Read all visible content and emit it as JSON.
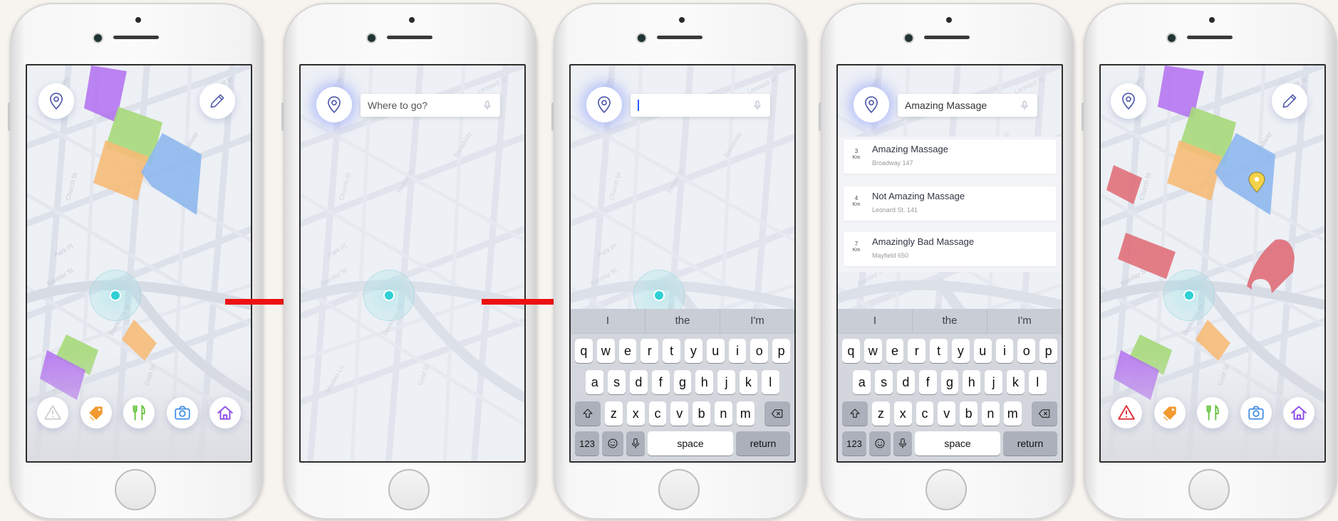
{
  "search": {
    "placeholder": "Where to go?",
    "query": "Amazing Massage"
  },
  "keyboard": {
    "suggestions": [
      "I",
      "the",
      "I'm"
    ],
    "row1": [
      "q",
      "w",
      "e",
      "r",
      "t",
      "y",
      "u",
      "i",
      "o",
      "p"
    ],
    "row2": [
      "a",
      "s",
      "d",
      "f",
      "g",
      "h",
      "j",
      "k",
      "l"
    ],
    "row3": [
      "z",
      "x",
      "c",
      "v",
      "b",
      "n",
      "m"
    ],
    "numbers_label": "123",
    "space_label": "space",
    "return_label": "return"
  },
  "results": [
    {
      "distance": "3",
      "unit": "Km",
      "title": "Amazing Massage",
      "address": "Broadway 147"
    },
    {
      "distance": "4",
      "unit": "Km",
      "title": "Not Amazing Massage",
      "address": "Leonard St. 141"
    },
    {
      "distance": "7",
      "unit": "Km",
      "title": "Amazingly Bad Massage",
      "address": "Mayfield 650"
    }
  ],
  "toolbar_icons": [
    "warning-icon",
    "tag-icon",
    "fork-knife-icon",
    "camera-icon",
    "home-icon"
  ],
  "colors": {
    "purple_zone": "#b26ef0",
    "green_zone": "#a6d97a",
    "orange_zone": "#f6bb78",
    "blue_zone": "#8eb8ee",
    "red_zone": "#e0707a",
    "location_dot": "#2fd0d5",
    "arrow": "#ee1111",
    "pin": "#f2d24a"
  }
}
